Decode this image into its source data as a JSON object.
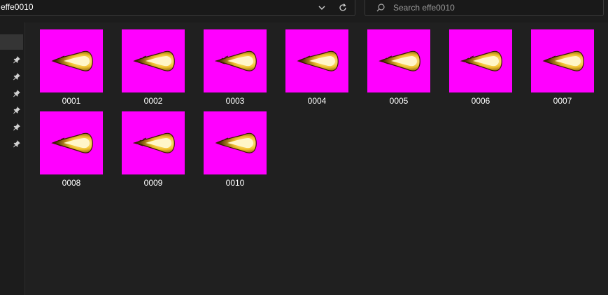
{
  "addressbar": {
    "crumb": "effe0010",
    "dropdown_icon": "chevron-down-icon",
    "refresh_icon": "refresh-icon"
  },
  "search": {
    "placeholder": "Search effe0010",
    "value": "",
    "icon": "search-icon"
  },
  "sidebar": {
    "pins": [
      "pin-icon",
      "pin-icon",
      "pin-icon",
      "pin-icon",
      "pin-icon",
      "pin-icon"
    ]
  },
  "files": [
    {
      "name": "0001"
    },
    {
      "name": "0002"
    },
    {
      "name": "0003"
    },
    {
      "name": "0004"
    },
    {
      "name": "0005"
    },
    {
      "name": "0006"
    },
    {
      "name": "0007"
    },
    {
      "name": "0008"
    },
    {
      "name": "0009"
    },
    {
      "name": "0010"
    }
  ],
  "colors": {
    "thumbnail_background": "#ff00ff",
    "flame_core": "#fff6c8",
    "flame_mid": "#f2c230",
    "flame_edge": "#3a1a00"
  }
}
